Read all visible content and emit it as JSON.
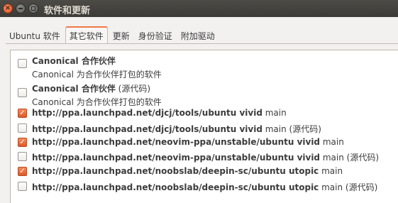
{
  "window": {
    "title": "软件和更新",
    "close_symbol": "×"
  },
  "tabs": [
    {
      "label": "Ubuntu 软件",
      "active": false
    },
    {
      "label": "其它软件",
      "active": true
    },
    {
      "label": "更新",
      "active": false
    },
    {
      "label": "身份验证",
      "active": false
    },
    {
      "label": "附加驱动",
      "active": false
    }
  ],
  "sources": [
    {
      "checked": false,
      "name": "Canonical 合作伙伴",
      "suffix": "",
      "description": "Canonical 为合作伙伴打包的软件"
    },
    {
      "checked": false,
      "name": "Canonical 合作伙伴",
      "suffix": " (源代码)",
      "description": "Canonical 为合作伙伴打包的软件"
    },
    {
      "checked": true,
      "url": "http://ppa.launchpad.net/djcj/tools/ubuntu vivid",
      "component": " main"
    },
    {
      "checked": false,
      "url": "http://ppa.launchpad.net/djcj/tools/ubuntu vivid",
      "component": " main (源代码)"
    },
    {
      "checked": true,
      "url": "http://ppa.launchpad.net/neovim-ppa/unstable/ubuntu vivid",
      "component": " main"
    },
    {
      "checked": false,
      "url": "http://ppa.launchpad.net/neovim-ppa/unstable/ubuntu vivid",
      "component": " main (源代码)"
    },
    {
      "checked": true,
      "url": "http://ppa.launchpad.net/noobslab/deepin-sc/ubuntu utopic",
      "component": " main"
    },
    {
      "checked": false,
      "url": "http://ppa.launchpad.net/noobslab/deepin-sc/ubuntu utopic",
      "component": " main (源代码)"
    }
  ],
  "colors": {
    "accent": "#e2552a",
    "titlebar": "#3c3b37",
    "window_bg": "#f2f1f0"
  },
  "check_mark": "✓"
}
